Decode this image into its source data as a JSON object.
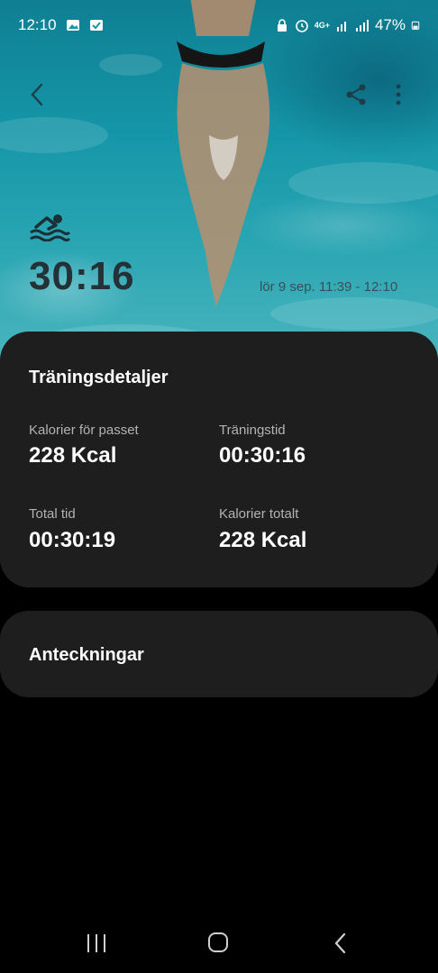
{
  "status_bar": {
    "time": "12:10",
    "network": "4G+",
    "battery": "47%",
    "icons": [
      "gallery-icon",
      "check-icon",
      "lock-icon",
      "alarm-icon",
      "wifi-icon",
      "signal-icon",
      "battery-icon"
    ]
  },
  "hero": {
    "background": "swimmer-in-pool-photo",
    "duration": "30:16",
    "date_range": "lör 9 sep. 11:39 - 12:10"
  },
  "details": {
    "title": "Träningsdetaljer",
    "stats": [
      {
        "label": "Kalorier för passet",
        "value": "228 Kcal"
      },
      {
        "label": "Träningstid",
        "value": "00:30:16"
      },
      {
        "label": "Total tid",
        "value": "00:30:19"
      },
      {
        "label": "Kalorier totalt",
        "value": "228 Kcal"
      }
    ]
  },
  "notes": {
    "title": "Anteckningar"
  },
  "colors": {
    "card": "#1e1e1e",
    "background": "#000000",
    "label": "#b3b3b3",
    "water": "#1596a8"
  }
}
